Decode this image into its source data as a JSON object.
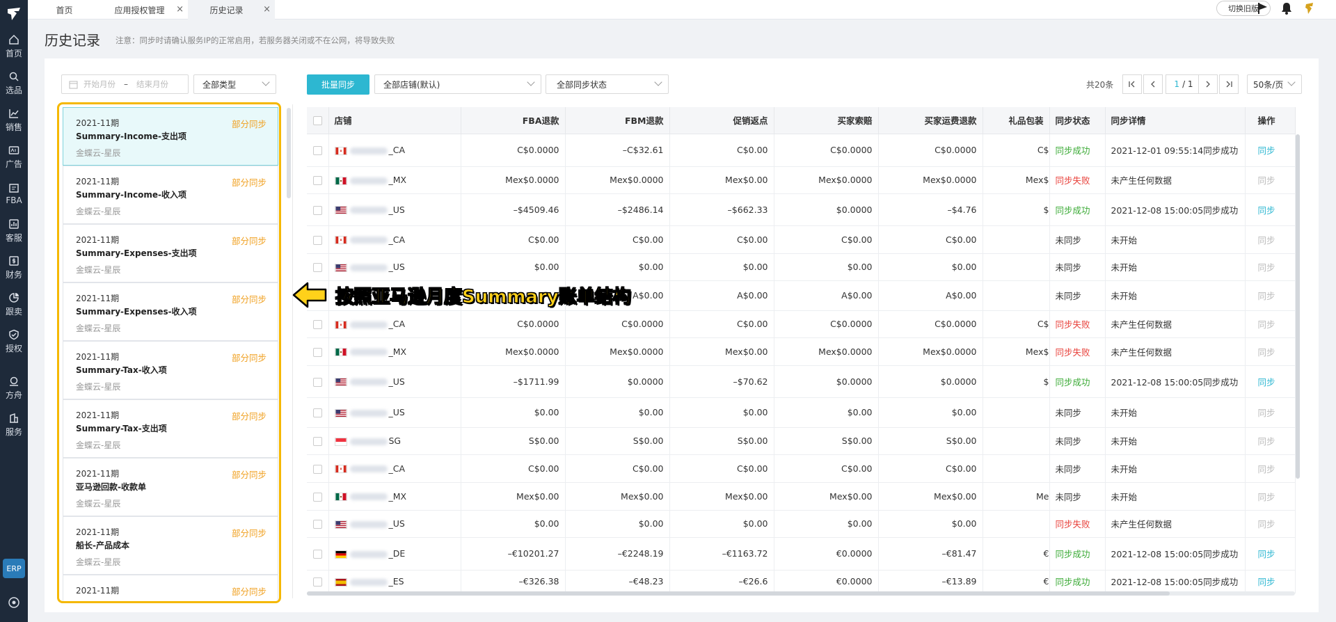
{
  "sidebar": {
    "items": [
      {
        "label": "首页",
        "icon": "home-icon"
      },
      {
        "label": "选品",
        "icon": "search-icon"
      },
      {
        "label": "销售",
        "icon": "chart-icon"
      },
      {
        "label": "广告",
        "icon": "ad-icon"
      },
      {
        "label": "FBA",
        "icon": "fba-icon"
      },
      {
        "label": "客服",
        "icon": "service-icon"
      },
      {
        "label": "财务",
        "icon": "finance-icon"
      },
      {
        "label": "跟卖",
        "icon": "pie-icon"
      },
      {
        "label": "授权",
        "icon": "shield-icon"
      },
      {
        "label": "方舟",
        "icon": "ark-icon"
      },
      {
        "label": "服务",
        "icon": "building-icon"
      }
    ],
    "erp": "ERP"
  },
  "tabs": [
    {
      "label": "首页"
    },
    {
      "label": "应用授权管理",
      "close": "×"
    },
    {
      "label": "历史记录",
      "close": "×"
    }
  ],
  "topbar": {
    "switch_label": "切换旧版"
  },
  "page": {
    "title": "历史记录",
    "notice": "注意：同步时请确认服务IP的正常启用，若服务器关闭或不在公网，将导致失败"
  },
  "filters": {
    "start_month": "开始月份",
    "dash": "–",
    "end_month": "结束月份",
    "type": "全部类型"
  },
  "left_list": [
    {
      "period": "2021-11期",
      "title": "Summary-Income-支出项",
      "source": "金蝶云-星辰",
      "status": "部分同步"
    },
    {
      "period": "2021-11期",
      "title": "Summary-Income-收入项",
      "source": "金蝶云-星辰",
      "status": "部分同步"
    },
    {
      "period": "2021-11期",
      "title": "Summary-Expenses-支出项",
      "source": "金蝶云-星辰",
      "status": "部分同步"
    },
    {
      "period": "2021-11期",
      "title": "Summary-Expenses-收入项",
      "source": "金蝶云-星辰",
      "status": "部分同步"
    },
    {
      "period": "2021-11期",
      "title": "Summary-Tax-收入项",
      "source": "金蝶云-星辰",
      "status": "部分同步"
    },
    {
      "period": "2021-11期",
      "title": "Summary-Tax-支出项",
      "source": "金蝶云-星辰",
      "status": "部分同步"
    },
    {
      "period": "2021-11期",
      "title": "亚马逊回款-收款单",
      "source": "金蝶云-星辰",
      "status": "部分同步"
    },
    {
      "period": "2021-11期",
      "title": "船长-产品成本",
      "source": "金蝶云-星辰",
      "status": "部分同步"
    },
    {
      "period": "2021-11期",
      "title": "",
      "source": "",
      "status": "部分同步"
    }
  ],
  "toolbar": {
    "batch_sync": "批量同步",
    "store_filter": "全部店铺(默认)",
    "status_filter": "全部同步状态",
    "total": "共20条",
    "page_current": "1",
    "page_total": "/ 1",
    "page_size": "50条/页"
  },
  "callout": "按照亚马逊月度Summary账单结构",
  "table": {
    "headers": {
      "store": "店铺",
      "fba": "FBA退款",
      "fbm": "FBM退款",
      "promo": "促销返点",
      "claim": "买家索赔",
      "ship": "买家运费退款",
      "gift": "礼品包装",
      "status": "同步状态",
      "detail": "同步详情",
      "ops": "操作"
    },
    "rows": [
      {
        "flag": "ca",
        "store": "_CA",
        "fba": "C$0.0000",
        "fbm": "–C$32.61",
        "promo": "C$0.00",
        "claim": "C$0.0000",
        "ship": "C$0.0000",
        "gift": "C$",
        "status": "同步成功",
        "st": "ok",
        "detail": "2021-12-01 09:55:14同步成功",
        "op": "同步",
        "opon": true
      },
      {
        "flag": "mx",
        "store": "_MX",
        "fba": "Mex$0.0000",
        "fbm": "Mex$0.0000",
        "promo": "Mex$0.00",
        "claim": "Mex$0.0000",
        "ship": "Mex$0.0000",
        "gift": "Mex$",
        "status": "同步失败",
        "st": "fail",
        "detail": "未产生任何数据",
        "op": "同步",
        "opon": false
      },
      {
        "flag": "us",
        "store": "_US",
        "fba": "–$4509.46",
        "fbm": "–$2486.14",
        "promo": "–$662.33",
        "claim": "$0.0000",
        "ship": "–$4.76",
        "gift": "$",
        "status": "同步成功",
        "st": "ok",
        "detail": "2021-12-08 15:00:05同步成功",
        "op": "同步",
        "opon": true
      },
      {
        "flag": "ca",
        "store": "_CA",
        "fba": "C$0.00",
        "fbm": "C$0.00",
        "promo": "C$0.00",
        "claim": "C$0.00",
        "ship": "C$0.00",
        "gift": "",
        "status": "未同步",
        "st": "",
        "detail": "未开始",
        "op": "同步",
        "opon": false
      },
      {
        "flag": "us",
        "store": "_US",
        "fba": "$0.00",
        "fbm": "$0.00",
        "promo": "$0.00",
        "claim": "$0.00",
        "ship": "$0.00",
        "gift": "",
        "status": "未同步",
        "st": "",
        "detail": "未开始",
        "op": "同步",
        "opon": false
      },
      {
        "flag": "",
        "store": "",
        "fba": "",
        "fbm": "A$0.00",
        "promo": "A$0.00",
        "claim": "A$0.00",
        "ship": "A$0.00",
        "gift": "",
        "status": "未同步",
        "st": "",
        "detail": "未开始",
        "op": "同步",
        "opon": false
      },
      {
        "flag": "ca",
        "store": "_CA",
        "fba": "C$0.0000",
        "fbm": "C$0.0000",
        "promo": "C$0.00",
        "claim": "C$0.0000",
        "ship": "C$0.0000",
        "gift": "C$",
        "status": "同步失败",
        "st": "fail",
        "detail": "未产生任何数据",
        "op": "同步",
        "opon": false
      },
      {
        "flag": "mx",
        "store": "_MX",
        "fba": "Mex$0.0000",
        "fbm": "Mex$0.0000",
        "promo": "Mex$0.00",
        "claim": "Mex$0.0000",
        "ship": "Mex$0.0000",
        "gift": "Mex$",
        "status": "同步失败",
        "st": "fail",
        "detail": "未产生任何数据",
        "op": "同步",
        "opon": false
      },
      {
        "flag": "us",
        "store": "_US",
        "fba": "–$1711.99",
        "fbm": "$0.0000",
        "promo": "–$70.62",
        "claim": "$0.0000",
        "ship": "$0.0000",
        "gift": "$",
        "status": "同步成功",
        "st": "ok",
        "detail": "2021-12-08 15:00:05同步成功",
        "op": "同步",
        "opon": true
      },
      {
        "flag": "us",
        "store": "_US",
        "fba": "$0.00",
        "fbm": "$0.00",
        "promo": "$0.00",
        "claim": "$0.00",
        "ship": "$0.00",
        "gift": "",
        "status": "未同步",
        "st": "",
        "detail": "未开始",
        "op": "同步",
        "opon": false
      },
      {
        "flag": "sg",
        "store": "SG",
        "fba": "S$0.00",
        "fbm": "S$0.00",
        "promo": "S$0.00",
        "claim": "S$0.00",
        "ship": "S$0.00",
        "gift": "",
        "status": "未同步",
        "st": "",
        "detail": "未开始",
        "op": "同步",
        "opon": false
      },
      {
        "flag": "ca",
        "store": "_CA",
        "fba": "C$0.00",
        "fbm": "C$0.00",
        "promo": "C$0.00",
        "claim": "C$0.00",
        "ship": "C$0.00",
        "gift": "",
        "status": "未同步",
        "st": "",
        "detail": "未开始",
        "op": "同步",
        "opon": false
      },
      {
        "flag": "mx",
        "store": "_MX",
        "fba": "Mex$0.00",
        "fbm": "Mex$0.00",
        "promo": "Mex$0.00",
        "claim": "Mex$0.00",
        "ship": "Mex$0.00",
        "gift": "Me",
        "status": "未同步",
        "st": "",
        "detail": "未开始",
        "op": "同步",
        "opon": false
      },
      {
        "flag": "us",
        "store": "_US",
        "fba": "$0.00",
        "fbm": "$0.00",
        "promo": "$0.00",
        "claim": "$0.00",
        "ship": "$0.00",
        "gift": "",
        "status": "同步失败",
        "st": "fail",
        "detail": "未产生任何数据",
        "op": "同步",
        "opon": false
      },
      {
        "flag": "de",
        "store": "_DE",
        "fba": "–€10201.27",
        "fbm": "–€2248.19",
        "promo": "–€1163.72",
        "claim": "€0.0000",
        "ship": "–€81.47",
        "gift": "€",
        "status": "同步成功",
        "st": "ok",
        "detail": "2021-12-08 15:00:05同步成功",
        "op": "同步",
        "opon": true
      },
      {
        "flag": "es",
        "store": "_ES",
        "fba": "–€326.38",
        "fbm": "–€48.23",
        "promo": "–€26.6",
        "claim": "€0.0000",
        "ship": "–€13.89",
        "gift": "€",
        "status": "同步成功",
        "st": "ok",
        "detail": "2021-12-08 15:00:05同步成功",
        "op": "同步",
        "opon": true
      }
    ]
  }
}
